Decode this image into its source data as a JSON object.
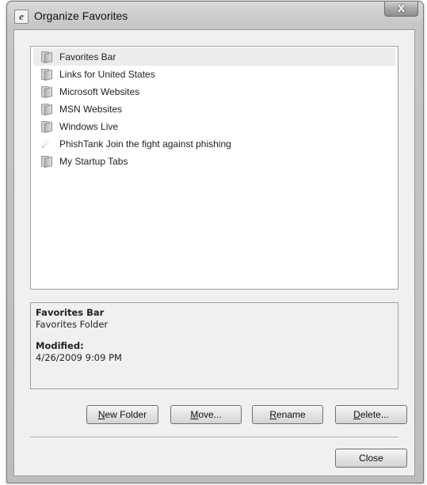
{
  "window": {
    "title": "Organize Favorites",
    "app_icon_glyph": "e",
    "close_glyph": "X"
  },
  "favorites_list": {
    "items": [
      {
        "label": "Favorites Bar",
        "icon": "folder-icon",
        "selected": true
      },
      {
        "label": "Links for United States",
        "icon": "folder-icon",
        "selected": false
      },
      {
        "label": "Microsoft Websites",
        "icon": "folder-icon",
        "selected": false
      },
      {
        "label": "MSN Websites",
        "icon": "folder-icon",
        "selected": false
      },
      {
        "label": "Windows Live",
        "icon": "folder-icon",
        "selected": false
      },
      {
        "label": "PhishTank  Join the fight against phishing",
        "icon": "link-icon",
        "selected": false
      },
      {
        "label": "My Startup Tabs",
        "icon": "folder-icon",
        "selected": false
      }
    ]
  },
  "details": {
    "name": "Favorites Bar",
    "type": "Favorites Folder",
    "modified_label": "Modified:",
    "modified_value": "4/26/2009 9:09 PM"
  },
  "buttons": {
    "new_folder": {
      "hotkey": "N",
      "rest": "ew Folder"
    },
    "move": {
      "hotkey": "M",
      "rest": "ove..."
    },
    "rename": {
      "hotkey": "R",
      "rest": "ename"
    },
    "delete": {
      "hotkey": "D",
      "rest": "elete..."
    },
    "close": "Close"
  }
}
